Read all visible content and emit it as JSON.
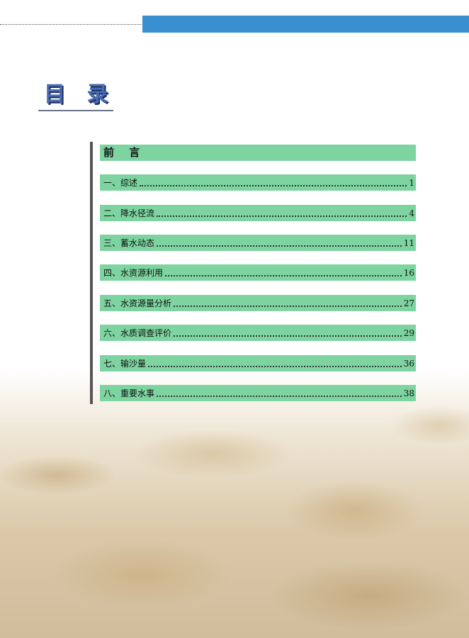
{
  "header": {
    "title": "目 录"
  },
  "toc": {
    "heading": "前 言",
    "entries": [
      {
        "label": "一、综述",
        "page": "1"
      },
      {
        "label": "二、降水径流",
        "page": "4"
      },
      {
        "label": "三、蓄水动态",
        "page": "11"
      },
      {
        "label": "四、水资源利用",
        "page": "16"
      },
      {
        "label": "五、水资源量分析",
        "page": "27"
      },
      {
        "label": "六、水质调查评价",
        "page": "29"
      },
      {
        "label": "七、输沙量",
        "page": "36"
      },
      {
        "label": "八、重要水事",
        "page": "38"
      }
    ]
  },
  "colors": {
    "top_bar": "#3a8fd0",
    "entry_background": "#7dd4a0",
    "title": "#4a6cb3"
  }
}
